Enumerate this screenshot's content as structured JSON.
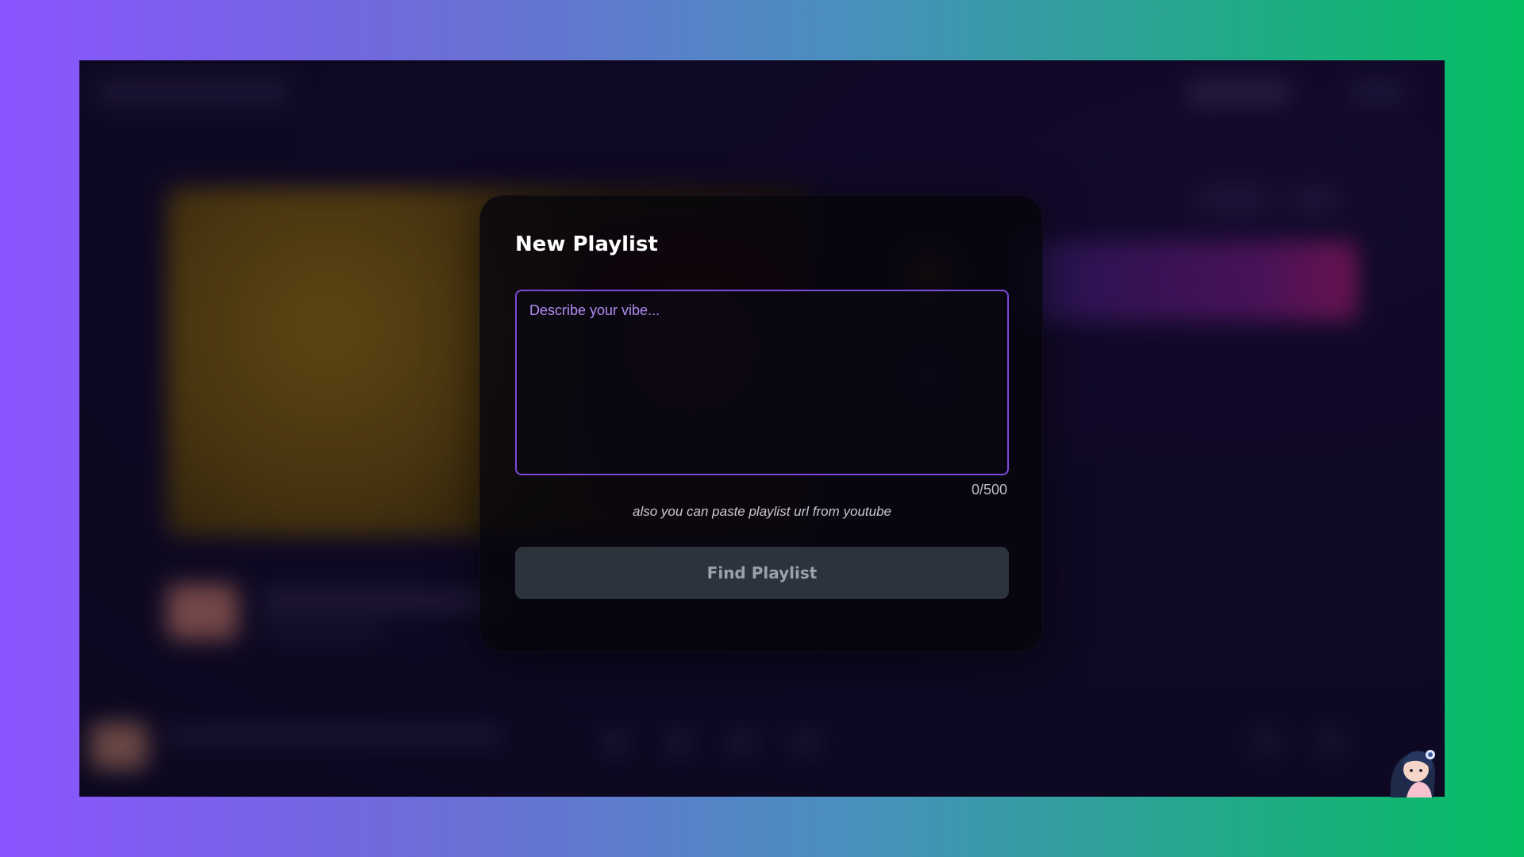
{
  "modal": {
    "title": "New Playlist",
    "input": {
      "placeholder": "Describe your vibe...",
      "value": ""
    },
    "char_count": "0/500",
    "hint": "also you can paste playlist url from youtube",
    "find_button_label": "Find Playlist"
  },
  "colors": {
    "accent": "#7d48d8",
    "placeholder": "#b08cf2",
    "button_disabled": "#2d333c"
  },
  "icons": [
    "mascot-avatar-icon"
  ]
}
